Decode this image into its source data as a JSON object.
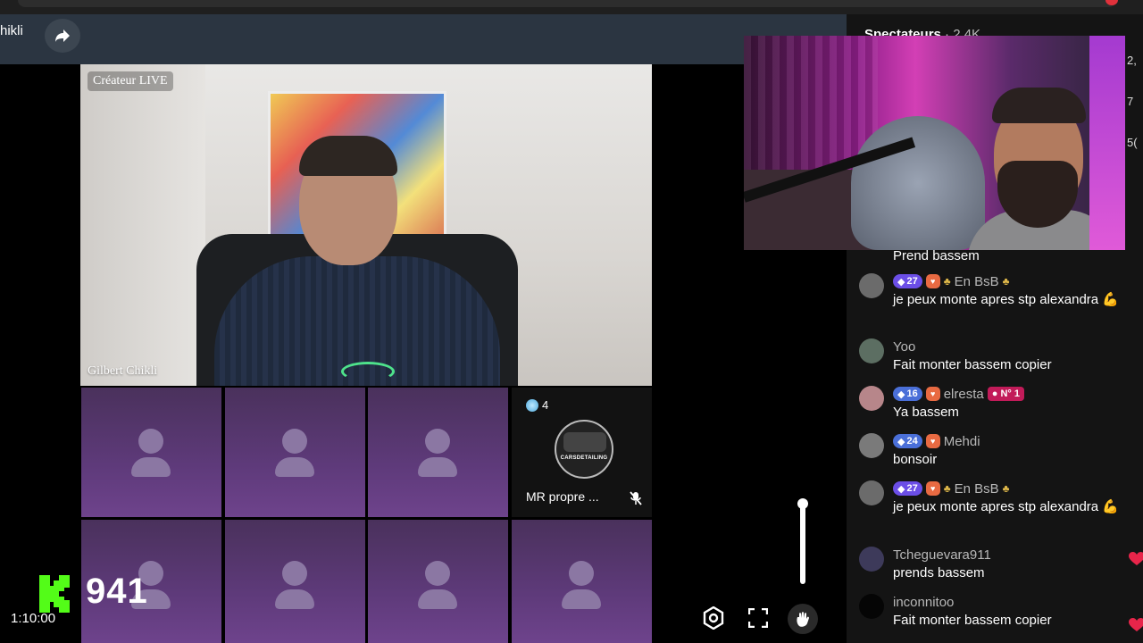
{
  "header": {
    "partial_name": "hikli"
  },
  "host": {
    "tag": "Créateur LIVE",
    "name": "Gilbert Chikli"
  },
  "guest": {
    "gem_count": "4",
    "avatar_text": "CARSDETAILING",
    "name": "MR propre ..."
  },
  "overlay": {
    "k_count": "941",
    "timer": "1:10:00"
  },
  "chat": {
    "title": "Spectateurs",
    "viewer_count": "· 2,4K",
    "side_numbers": [
      "2,",
      "7",
      "5("
    ],
    "partial_top_message": "Prend bassem",
    "messages": [
      {
        "level": "27",
        "level_color": "#6b4ee6",
        "fan": true,
        "clover": true,
        "username": "En BsB",
        "username_suffix_clover": true,
        "text": "je peux monte apres stp alexandra 💪",
        "avatar_color": "#6b6b6b"
      },
      {
        "level": "",
        "fan": false,
        "clover": false,
        "username": "Yoo",
        "text": "Fait monter bassem copier",
        "avatar_color": "#5c6e62"
      },
      {
        "level": "16",
        "level_color": "#4a6fd8",
        "fan": true,
        "clover": false,
        "username": "elresta",
        "rank": "N° 1",
        "text": "Ya bassem",
        "avatar_color": "#b7868a"
      },
      {
        "level": "24",
        "level_color": "#4a6fd8",
        "fan": true,
        "clover": false,
        "username": "Mehdi",
        "text": "bonsoir",
        "avatar_color": "#7a7a7a"
      },
      {
        "level": "27",
        "level_color": "#6b4ee6",
        "fan": true,
        "clover": true,
        "username": "En BsB",
        "username_suffix_clover": true,
        "text": "je peux monte apres stp alexandra 💪",
        "avatar_color": "#6b6b6b"
      },
      {
        "level": "",
        "fan": false,
        "clover": false,
        "username": "Tcheguevara911",
        "text": "prends bassem",
        "avatar_color": "#3d3a5a"
      },
      {
        "level": "",
        "fan": false,
        "clover": false,
        "username": "inconnitoo",
        "text": "Fait monter bassem copier",
        "avatar_color": "#050505"
      }
    ]
  },
  "colors": {
    "header_bg": "#2b3541",
    "tile_purple": "#5e3a7a",
    "k_green": "#53fc18",
    "heart_red": "#e8254a"
  }
}
